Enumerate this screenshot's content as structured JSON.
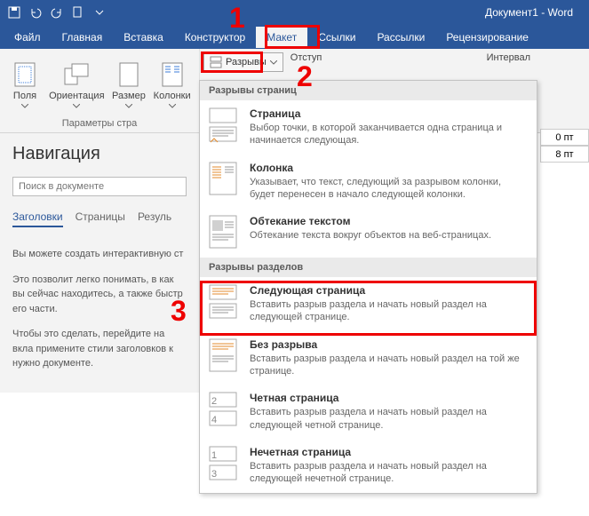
{
  "titlebar": {
    "doc_title": "Документ1 - Word"
  },
  "menu": {
    "file": "Файл",
    "home": "Главная",
    "insert": "Вставка",
    "design": "Конструктор",
    "layout": "Макет",
    "references": "Ссылки",
    "mailings": "Рассылки",
    "review": "Рецензирование"
  },
  "ribbon": {
    "margins": "Поля",
    "orientation": "Ориентация",
    "size": "Размер",
    "columns": "Колонки",
    "breaks": "Разрывы",
    "page_setup_group": "Параметры стра",
    "indent_label": "Отступ",
    "spacing_label": "Интервал",
    "spacing_before": "0 пт",
    "spacing_after": "8 пт"
  },
  "nav": {
    "title": "Навигация",
    "search_placeholder": "Поиск в документе",
    "tab_headings": "Заголовки",
    "tab_pages": "Страницы",
    "tab_results": "Резуль",
    "p1": "Вы можете создать интерактивную ст",
    "p2": "Это позволит легко понимать, в как вы сейчас находитесь, а также быстр его части.",
    "p3": "Чтобы это сделать, перейдите на вкла примените стили заголовков к нужно документе."
  },
  "dropdown": {
    "h_pages": "Разрывы страниц",
    "h_sections": "Разрывы разделов",
    "page_t": "Страница",
    "page_d": "Выбор точки, в которой заканчивается одна страница и начинается следующая.",
    "col_t": "Колонка",
    "col_d": "Указывает, что текст, следующий за разрывом колонки, будет перенесен в начало следующей колонки.",
    "wrap_t": "Обтекание текстом",
    "wrap_d": "Обтекание текста вокруг объектов на веб-страницах.",
    "next_t": "Следующая страница",
    "next_d": "Вставить разрыв раздела и начать новый раздел на следующей странице.",
    "cont_t": "Без разрыва",
    "cont_d": "Вставить разрыв раздела и начать новый раздел на той же странице.",
    "even_t": "Четная страница",
    "even_d": "Вставить разрыв раздела и начать новый раздел на следующей четной странице.",
    "odd_t": "Нечетная страница",
    "odd_d": "Вставить разрыв раздела и начать новый раздел на следующей нечетной странице."
  },
  "annot": {
    "n1": "1",
    "n2": "2",
    "n3": "3"
  }
}
